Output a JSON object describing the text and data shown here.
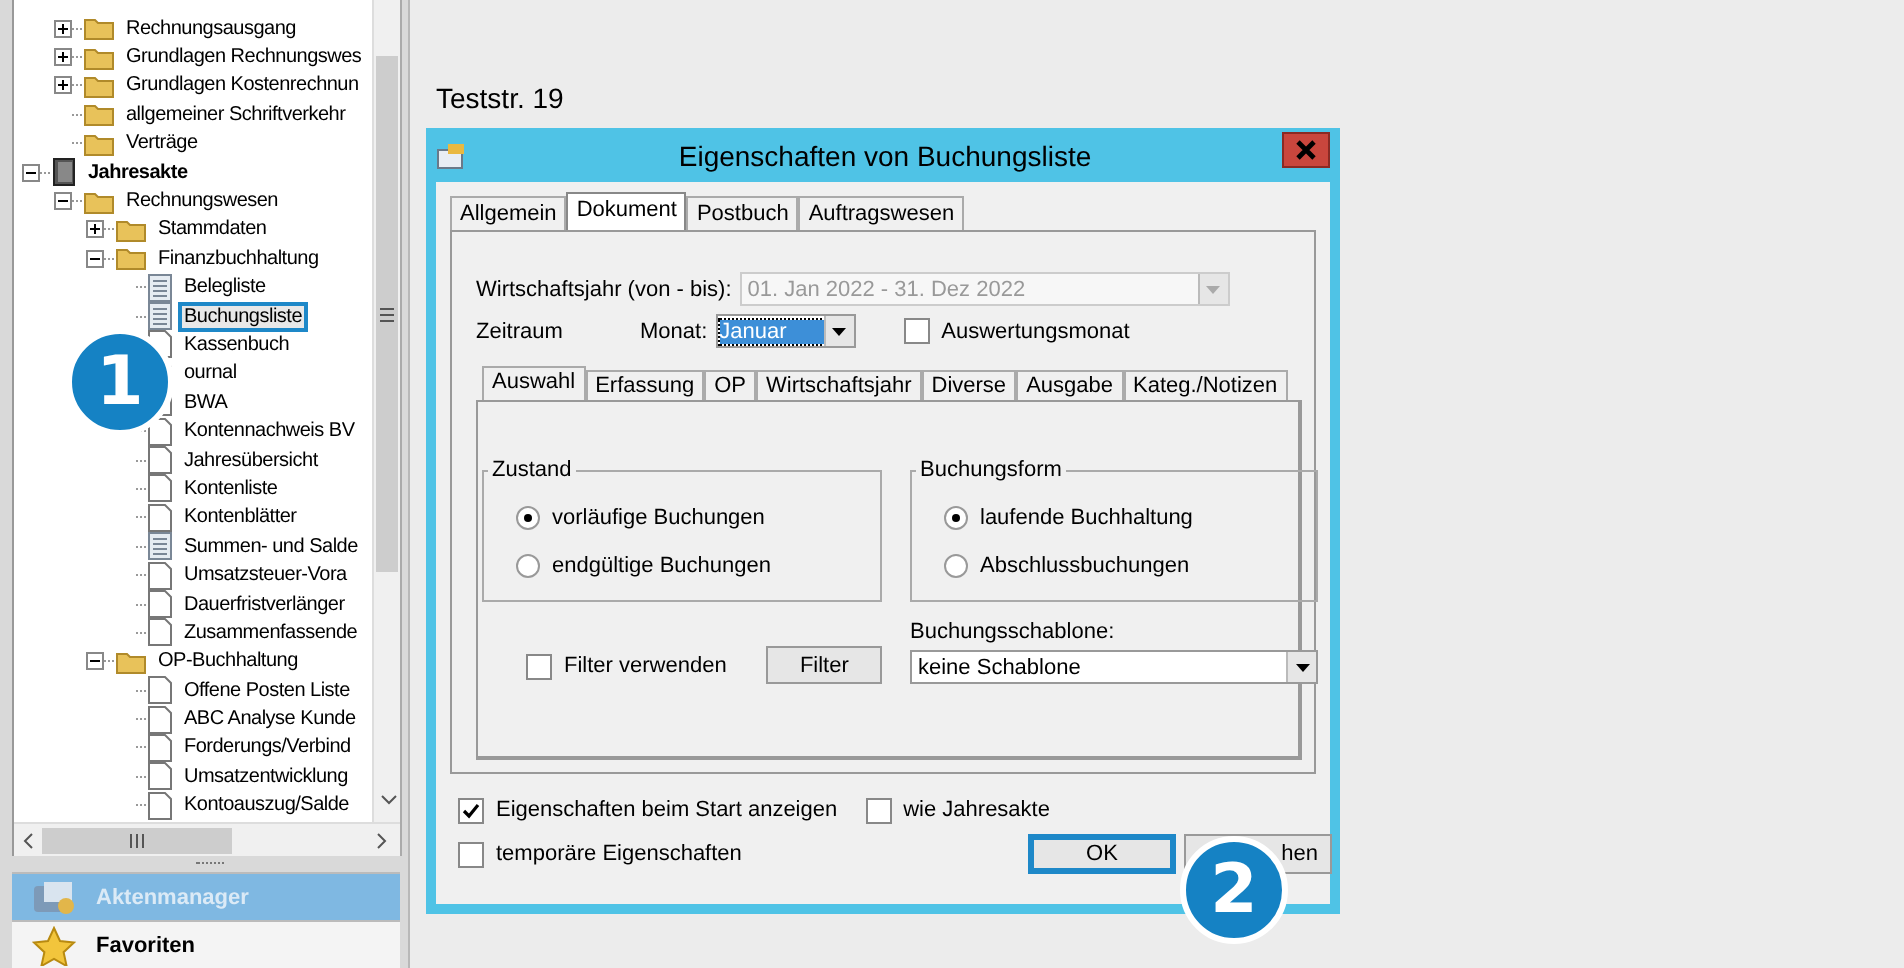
{
  "sidebar": {
    "tree": {
      "continued_items": [
        {
          "label": "Rechnungsausgang",
          "kind": "folder",
          "expanded": false,
          "selected": false
        },
        {
          "label": "Grundlagen Rechnungswes",
          "kind": "folder",
          "expanded": false,
          "selected": false
        },
        {
          "label": "Grundlagen Kostenrechnun",
          "kind": "folder",
          "expanded": false,
          "selected": false
        },
        {
          "label": "allgemeiner Schriftverkehr",
          "kind": "folder",
          "selected": false
        },
        {
          "label": "Verträge",
          "kind": "folder",
          "selected": false
        }
      ],
      "items": [
        {
          "label": "Jahresakte",
          "kind": "binder",
          "expanded": true,
          "selected": false,
          "children": [
            {
              "label": "Rechnungswesen",
              "kind": "folder",
              "expanded": true,
              "selected": false,
              "children": [
                {
                  "label": "Stammdaten",
                  "kind": "folder",
                  "expanded": false,
                  "selected": false
                },
                {
                  "label": "Finanzbuchhaltung",
                  "kind": "folder",
                  "expanded": true,
                  "selected": false,
                  "children": [
                    {
                      "label": "Belegliste",
                      "kind": "list",
                      "selected": false
                    },
                    {
                      "label": "Buchungsliste",
                      "kind": "list",
                      "selected": true
                    },
                    {
                      "label": "Kassenbuch",
                      "kind": "page",
                      "selected": false
                    },
                    {
                      "label": "ournal",
                      "kind": "page",
                      "selected": false
                    },
                    {
                      "label": "BWA",
                      "kind": "page",
                      "selected": false
                    },
                    {
                      "label": "Kontennachweis BV",
                      "kind": "page",
                      "selected": false
                    },
                    {
                      "label": "Jahresübersicht",
                      "kind": "page",
                      "selected": false
                    },
                    {
                      "label": "Kontenliste",
                      "kind": "page",
                      "selected": false
                    },
                    {
                      "label": "Kontenblätter",
                      "kind": "page",
                      "selected": false
                    },
                    {
                      "label": "Summen- und Salde",
                      "kind": "list",
                      "selected": false
                    },
                    {
                      "label": "Umsatzsteuer-Vora",
                      "kind": "page",
                      "selected": false
                    },
                    {
                      "label": "Dauerfristverlänger",
                      "kind": "page",
                      "selected": false
                    },
                    {
                      "label": "Zusammenfassende",
                      "kind": "page",
                      "selected": false
                    }
                  ]
                },
                {
                  "label": "OP-Buchhaltung",
                  "kind": "folder",
                  "expanded": true,
                  "selected": false,
                  "children": [
                    {
                      "label": "Offene Posten Liste",
                      "kind": "page",
                      "selected": false
                    },
                    {
                      "label": "ABC Analyse Kunde",
                      "kind": "page",
                      "selected": false
                    },
                    {
                      "label": "Forderungs/Verbind",
                      "kind": "page",
                      "selected": false
                    },
                    {
                      "label": "Umsatzentwicklung",
                      "kind": "page",
                      "selected": false
                    },
                    {
                      "label": "Kontoauszug/Salde",
                      "kind": "page",
                      "selected": false
                    }
                  ]
                }
              ]
            }
          ]
        }
      ]
    },
    "nav_buttons": [
      {
        "label": "Aktenmanager",
        "kind": "files",
        "selected": true
      },
      {
        "label": "Favoriten",
        "kind": "star",
        "selected": false
      }
    ]
  },
  "address_lines": [
    "Teststr. 19"
  ],
  "dialog": {
    "title": "Eigenschaften von Buchungsliste",
    "tabs": [
      {
        "label": "Allgemein",
        "selected": false
      },
      {
        "label": "Dokument",
        "selected": true
      },
      {
        "label": "Postbuch",
        "selected": false
      },
      {
        "label": "Auftragswesen",
        "selected": false
      }
    ],
    "fiscal_year": {
      "label": "Wirtschaftsjahr (von - bis):",
      "value": "01. Jan 2022  -  31. Dez 2022",
      "disabled": true
    },
    "period": {
      "label": "Zeitraum",
      "month_label": "Monat:",
      "month_value": "Januar"
    },
    "evaluation_month": {
      "label": "Auswertungsmonat",
      "checked": false
    },
    "inner_tabs": [
      {
        "label": "Auswahl",
        "selected": true
      },
      {
        "label": "Erfassung",
        "selected": false
      },
      {
        "label": "OP",
        "selected": false
      },
      {
        "label": "Wirtschaftsjahr",
        "selected": false
      },
      {
        "label": "Diverse",
        "selected": false
      },
      {
        "label": "Ausgabe",
        "selected": false
      },
      {
        "label": "Kateg./Notizen",
        "selected": false
      }
    ],
    "groups": [
      {
        "title": "Zustand",
        "options": [
          {
            "label": "vorläufige Buchungen",
            "selected": true
          },
          {
            "label": "endgültige Buchungen",
            "selected": false
          }
        ]
      },
      {
        "title": "Buchungsform",
        "options": [
          {
            "label": "laufende Buchhaltung",
            "selected": true
          },
          {
            "label": "Abschlussbuchungen",
            "selected": false
          }
        ]
      }
    ],
    "filter_checkbox": {
      "label": "Filter verwenden",
      "checked": false
    },
    "filter_button": "Filter",
    "template": {
      "label": "Buchungsschablone:",
      "value": "keine Schablone"
    },
    "bottom_checkboxes": [
      {
        "label": "Eigenschaften beim Start anzeigen",
        "checked": true
      },
      {
        "label": "wie Jahresakte",
        "checked": false
      },
      {
        "label": "temporäre Eigenschaften",
        "checked": false
      }
    ],
    "buttons": [
      {
        "label": "OK",
        "highlighted": true
      },
      {
        "label": "hen",
        "highlighted": false
      }
    ]
  },
  "callouts": [
    "1",
    "2"
  ]
}
